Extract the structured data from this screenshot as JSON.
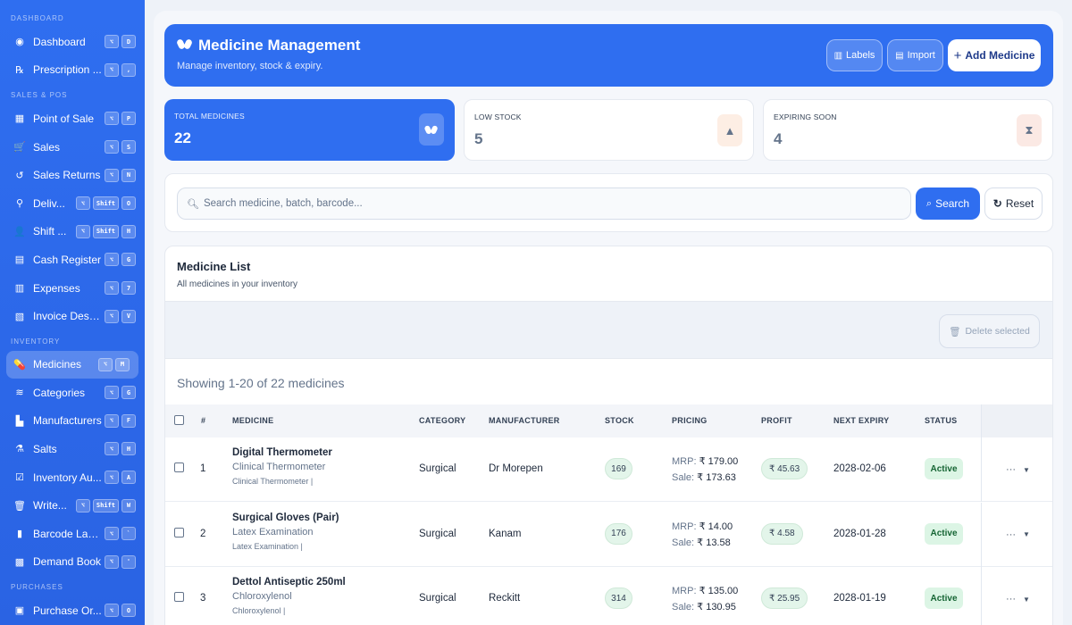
{
  "sidebar": {
    "sections": [
      {
        "title": "DASHBOARD",
        "items": [
          {
            "label": "Dashboard",
            "icon": "dashboard-icon",
            "glyph": "◉",
            "keys": [
              "⌥",
              "D"
            ]
          },
          {
            "label": "Prescription ...",
            "icon": "prescription-icon",
            "glyph": "℞",
            "keys": [
              "⌥",
              ","
            ]
          }
        ]
      },
      {
        "title": "SALES & POS",
        "items": [
          {
            "label": "Point of Sale",
            "icon": "pos-icon",
            "glyph": "▦",
            "keys": [
              "⌥",
              "P"
            ]
          },
          {
            "label": "Sales",
            "icon": "cart-icon",
            "glyph": "🛒",
            "keys": [
              "⌥",
              "S"
            ]
          },
          {
            "label": "Sales Returns",
            "icon": "return-icon",
            "glyph": "↺",
            "keys": [
              "⌥",
              "N"
            ]
          },
          {
            "label": "Deliv...",
            "icon": "bicycle-icon",
            "glyph": "⚲",
            "keys": [
              "⌥",
              "Shift",
              "O"
            ]
          },
          {
            "label": "Shift ...",
            "icon": "users-icon",
            "glyph": "👤",
            "keys": [
              "⌥",
              "Shift",
              "H"
            ]
          },
          {
            "label": "Cash Register",
            "icon": "register-icon",
            "glyph": "▤",
            "keys": [
              "⌥",
              "G"
            ]
          },
          {
            "label": "Expenses",
            "icon": "expenses-icon",
            "glyph": "▥",
            "keys": [
              "⌥",
              "7"
            ]
          },
          {
            "label": "Invoice Design",
            "icon": "invoice-icon",
            "glyph": "▧",
            "keys": [
              "⌥",
              "V"
            ]
          }
        ]
      },
      {
        "title": "INVENTORY",
        "items": [
          {
            "label": "Medicines",
            "icon": "pills-icon",
            "glyph": "💊",
            "keys": [
              "⌥",
              "M"
            ],
            "active": true
          },
          {
            "label": "Categories",
            "icon": "layers-icon",
            "glyph": "≋",
            "keys": [
              "⌥",
              "G"
            ]
          },
          {
            "label": "Manufacturers",
            "icon": "factory-icon",
            "glyph": "▙",
            "keys": [
              "⌥",
              "F"
            ]
          },
          {
            "label": "Salts",
            "icon": "flask-icon",
            "glyph": "⚗",
            "keys": [
              "⌥",
              "H"
            ]
          },
          {
            "label": "Inventory Au...",
            "icon": "audit-icon",
            "glyph": "☑",
            "keys": [
              "⌥",
              "A"
            ]
          },
          {
            "label": "Write...",
            "icon": "trash-icon",
            "glyph": "🗑",
            "keys": [
              "⌥",
              "Shift",
              "W"
            ]
          },
          {
            "label": "Barcode Lab...",
            "icon": "barcode-icon",
            "glyph": "▮",
            "keys": [
              "⌥",
              "`"
            ]
          },
          {
            "label": "Demand Book",
            "icon": "book-icon",
            "glyph": "▩",
            "keys": [
              "⌥",
              "'"
            ]
          }
        ]
      },
      {
        "title": "PURCHASES",
        "items": [
          {
            "label": "Purchase Or...",
            "icon": "purchase-icon",
            "glyph": "▣",
            "keys": [
              "⌥",
              "O"
            ]
          }
        ]
      }
    ]
  },
  "header": {
    "title": "Medicine Management",
    "subtitle": "Manage inventory, stock & expiry.",
    "labels_btn": "Labels",
    "import_btn": "Import",
    "add_btn": "Add Medicine"
  },
  "stats": [
    {
      "label": "TOTAL MEDICINES",
      "value": "22",
      "icon": "pills-icon"
    },
    {
      "label": "LOW STOCK",
      "value": "5",
      "icon": "warning-icon"
    },
    {
      "label": "EXPIRING SOON",
      "value": "4",
      "icon": "hourglass-icon"
    }
  ],
  "search": {
    "placeholder": "Search medicine, batch, barcode...",
    "search_btn": "Search",
    "reset_btn": "Reset"
  },
  "list": {
    "title": "Medicine List",
    "subtitle": "All medicines in your inventory",
    "delete_btn": "Delete selected",
    "showing": "Showing 1-20 of 22 medicines",
    "columns": [
      "#",
      "MEDICINE",
      "CATEGORY",
      "MANUFACTURER",
      "STOCK",
      "PRICING",
      "PROFIT",
      "NEXT EXPIRY",
      "STATUS"
    ],
    "rows": [
      {
        "num": "1",
        "name": "Digital Thermometer",
        "generic": "Clinical Thermometer",
        "meta": "Clinical Thermometer |",
        "category": "Surgical",
        "manufacturer": "Dr Morepen",
        "stock": "169",
        "mrp_label": "MRP:",
        "mrp": "₹ 179.00",
        "sale_label": "Sale:",
        "sale": "₹ 173.63",
        "profit": "₹ 45.63",
        "expiry": "2028-02-06",
        "status": "Active"
      },
      {
        "num": "2",
        "name": "Surgical Gloves (Pair)",
        "generic": "Latex Examination",
        "meta": "Latex Examination |",
        "category": "Surgical",
        "manufacturer": "Kanam",
        "stock": "176",
        "mrp_label": "MRP:",
        "mrp": "₹ 14.00",
        "sale_label": "Sale:",
        "sale": "₹ 13.58",
        "profit": "₹ 4.58",
        "expiry": "2028-01-28",
        "status": "Active"
      },
      {
        "num": "3",
        "name": "Dettol Antiseptic 250ml",
        "generic": "Chloroxylenol",
        "meta": "Chloroxylenol |",
        "category": "Surgical",
        "manufacturer": "Reckitt",
        "stock": "314",
        "mrp_label": "MRP:",
        "mrp": "₹ 135.00",
        "sale_label": "Sale:",
        "sale": "₹ 130.95",
        "profit": "₹ 25.95",
        "expiry": "2028-01-19",
        "status": "Active"
      }
    ]
  },
  "colors": {
    "accent": "#2f6ef0",
    "success": "#166534",
    "warning_bg": "#fdeee4",
    "expiry_bg": "#fbe9e4"
  }
}
